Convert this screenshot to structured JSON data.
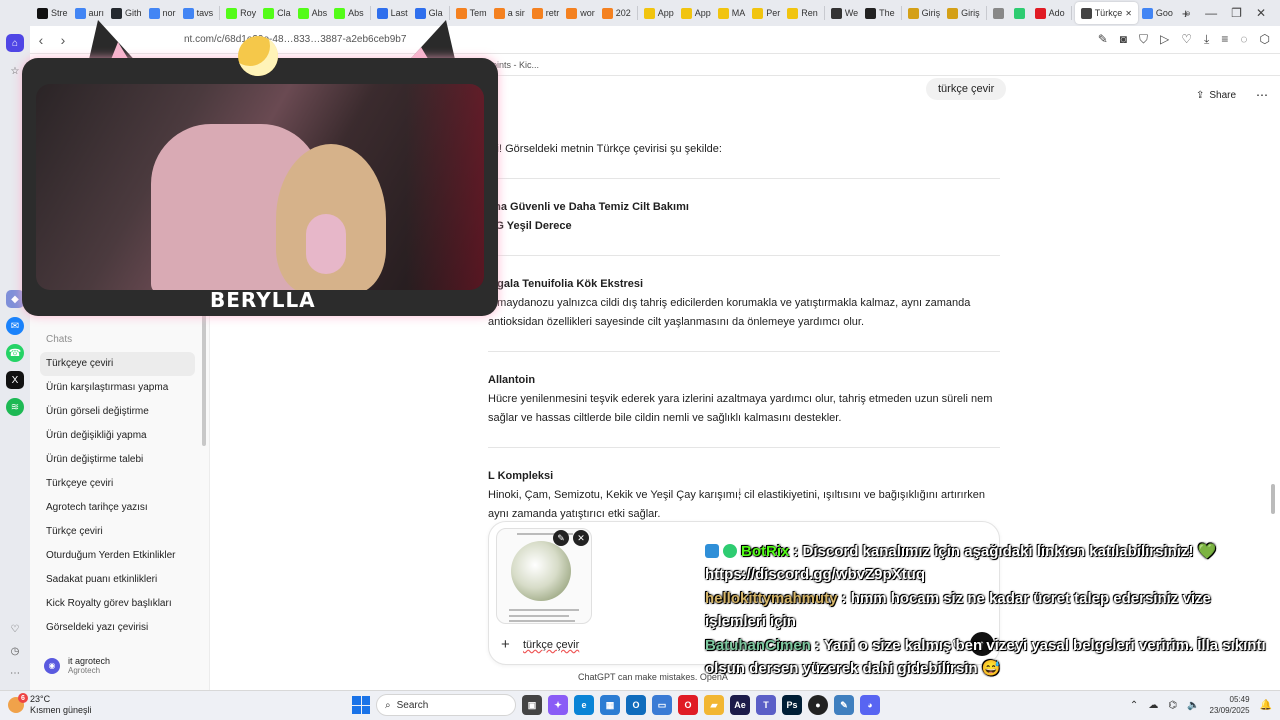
{
  "browser": {
    "tabs": [
      {
        "label": "Stre",
        "color": "#111111"
      },
      {
        "label": "aurı",
        "color": "#4285f4"
      },
      {
        "label": "Gith",
        "color": "#24292f"
      },
      {
        "label": "nor",
        "color": "#4285f4"
      },
      {
        "label": "tavs",
        "color": "#4285f4"
      },
      {
        "label": "Roy",
        "color": "#53fc18"
      },
      {
        "label": "Cla",
        "color": "#53fc18"
      },
      {
        "label": "Abs",
        "color": "#53fc18"
      },
      {
        "label": "Abs",
        "color": "#53fc18"
      },
      {
        "label": "Last",
        "color": "#2f6fed"
      },
      {
        "label": "Gla",
        "color": "#2f6fed"
      },
      {
        "label": "Tem",
        "color": "#f48120"
      },
      {
        "label": "a sir",
        "color": "#f48120"
      },
      {
        "label": "retr",
        "color": "#f48120"
      },
      {
        "label": "wor",
        "color": "#f48120"
      },
      {
        "label": "202",
        "color": "#f48120"
      },
      {
        "label": "App",
        "color": "#f1c40f"
      },
      {
        "label": "App",
        "color": "#f1c40f"
      },
      {
        "label": "MA",
        "color": "#f1c40f"
      },
      {
        "label": "Per",
        "color": "#f1c40f"
      },
      {
        "label": "Ren",
        "color": "#f1c40f"
      },
      {
        "label": "We",
        "color": "#333333"
      },
      {
        "label": "The",
        "color": "#222222"
      },
      {
        "label": "Giriş",
        "color": "#d4a017"
      },
      {
        "label": "Giriş",
        "color": "#d4a017"
      },
      {
        "label": "",
        "color": "#888888"
      },
      {
        "label": "",
        "color": "#2ecc71"
      },
      {
        "label": "Ado",
        "color": "#e01b24"
      },
      {
        "label": "Türkçe",
        "color": "#444444",
        "active": true
      },
      {
        "label": "Goo",
        "color": "#4285f4"
      }
    ],
    "new_tab": "+",
    "url": "nt.com/c/68d1e39e-48…833…3887-a2eb6ceb9b7",
    "bookmark": "Points - Kic..."
  },
  "sidebar": {
    "chats_heading": "Chats",
    "items": [
      "Türkçeye çeviri",
      "Ürün karşılaştırması yapma",
      "Ürün görseli değiştirme",
      "Ürün değişikliği yapma",
      "Ürün değiştirme talebi",
      "Türkçeye çeviri",
      "Agrotech tarihçe yazısı",
      "Türkçe çeviri",
      "Oturduğum Yerden Etkinlikler",
      "Sadakat puanı etkinlikleri",
      "Kick Royalty görev başlıkları",
      "Görseldeki yazı çevirisi"
    ],
    "user": {
      "name": "it agrotech",
      "sub": "Agrotech"
    }
  },
  "conversation": {
    "user_message": "türkçe çevir",
    "share_label": "Share",
    "intro": "bii! Görseldeki metnin Türkçe çevirisi şu şekilde:",
    "sections": [
      {
        "title": "aha Güvenli ve Daha Temiz Cilt Bakımı",
        "title2": "VG Yeşil Derece",
        "body": ""
      },
      {
        "title": "lygala Tenuifolia Kök Ekstresi",
        "body": "u maydanozu yalnızca cildi dış tahriş edicilerden korumakla ve yatıştırmakla kalmaz, aynı zamanda antioksidan özellikleri sayesinde cilt yaşlanmasını da önlemeye yardımcı olur."
      },
      {
        "title": "Allantoin",
        "body": "Hücre yenilenmesini teşvik ederek yara izlerini azaltmaya yardımcı olur, tahriş etmeden uzun süreli nem sağlar ve hassas ciltlerde bile cildin nemli ve sağlıklı kalmasını destekler."
      },
      {
        "title": "L Kompleksi",
        "body": "Hinoki, Çam, Semizotu, Kekik ve Yeşil Çay karışımı; cil elastikiyetini, ışıltısını ve bağışıklığını artırırken aynı zamanda yatıştırıcı etki sağlar."
      }
    ],
    "composer_text": "türkçe çevir",
    "disclaimer": "ChatGPT can make mistakes. OpenA"
  },
  "stream": {
    "streamer_name": "BERYLLA",
    "chat": [
      {
        "user": "BotRix",
        "user_color": "#53fc18",
        "text": ": Discord kanalımız için aşağıdaki linkten katılabilirsiniz! 💚 https://discord.gg/wbvZ9pXtuq"
      },
      {
        "user": "hellokittymahmuty",
        "user_color": "#d6b66a",
        "text": ": hmm hocam siz ne kadar ücret talep edersiniz vize işlemleri için"
      },
      {
        "user": "BatuhanCimen",
        "user_color": "#7ec8a0",
        "text": ": Yani o size kalmış ben vizeyi yasal belgeleri veririm. İlla sıkıntı olsun dersen yüzerek dahi gidebilirsin 😅"
      }
    ]
  },
  "taskbar": {
    "weather_temp": "23°C",
    "weather_desc": "Kısmen güneşli",
    "weather_badge": "6",
    "search_label": "Search",
    "time": "05:49",
    "date": "23/09/2025"
  }
}
